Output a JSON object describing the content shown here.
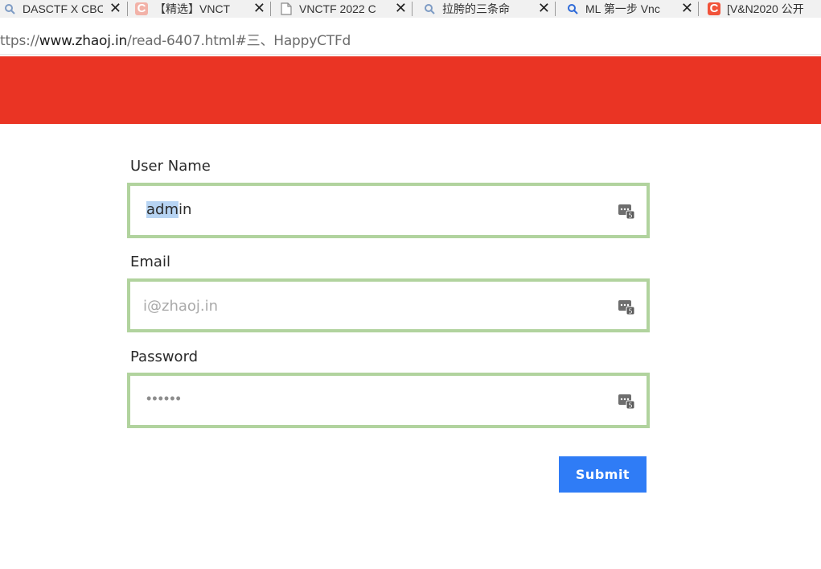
{
  "browser": {
    "tabs": [
      {
        "title": "DASCTF X CBC",
        "icon": "search-icon"
      },
      {
        "title": "【精选】VNCT",
        "icon": "csdn-c-icon-faded"
      },
      {
        "title": "VNCTF 2022 C",
        "icon": "document-icon"
      },
      {
        "title": "拉胯的三条命",
        "icon": "search-icon"
      },
      {
        "title": "ML 第一步 Vnc",
        "icon": "search-icon-blue"
      },
      {
        "title": "[V&N2020 公开",
        "icon": "csdn-c-icon"
      }
    ],
    "url_prefix": "ttps://",
    "url_host": "www.zhaoj.in",
    "url_path": "/read-6407.html#三、HappyCTFd"
  },
  "page": {
    "banner_color": "#ea3424",
    "form": {
      "username_label": "User Name",
      "username_value": "admin",
      "username_selected": "adm",
      "username_rest": "in",
      "email_label": "Email",
      "email_placeholder": "i@zhaoj.in",
      "password_label": "Password",
      "password_dots": "••••••",
      "submit_label": "Submit",
      "field_border_color": "#b1d39e",
      "submit_color": "#2f7cf6"
    }
  }
}
